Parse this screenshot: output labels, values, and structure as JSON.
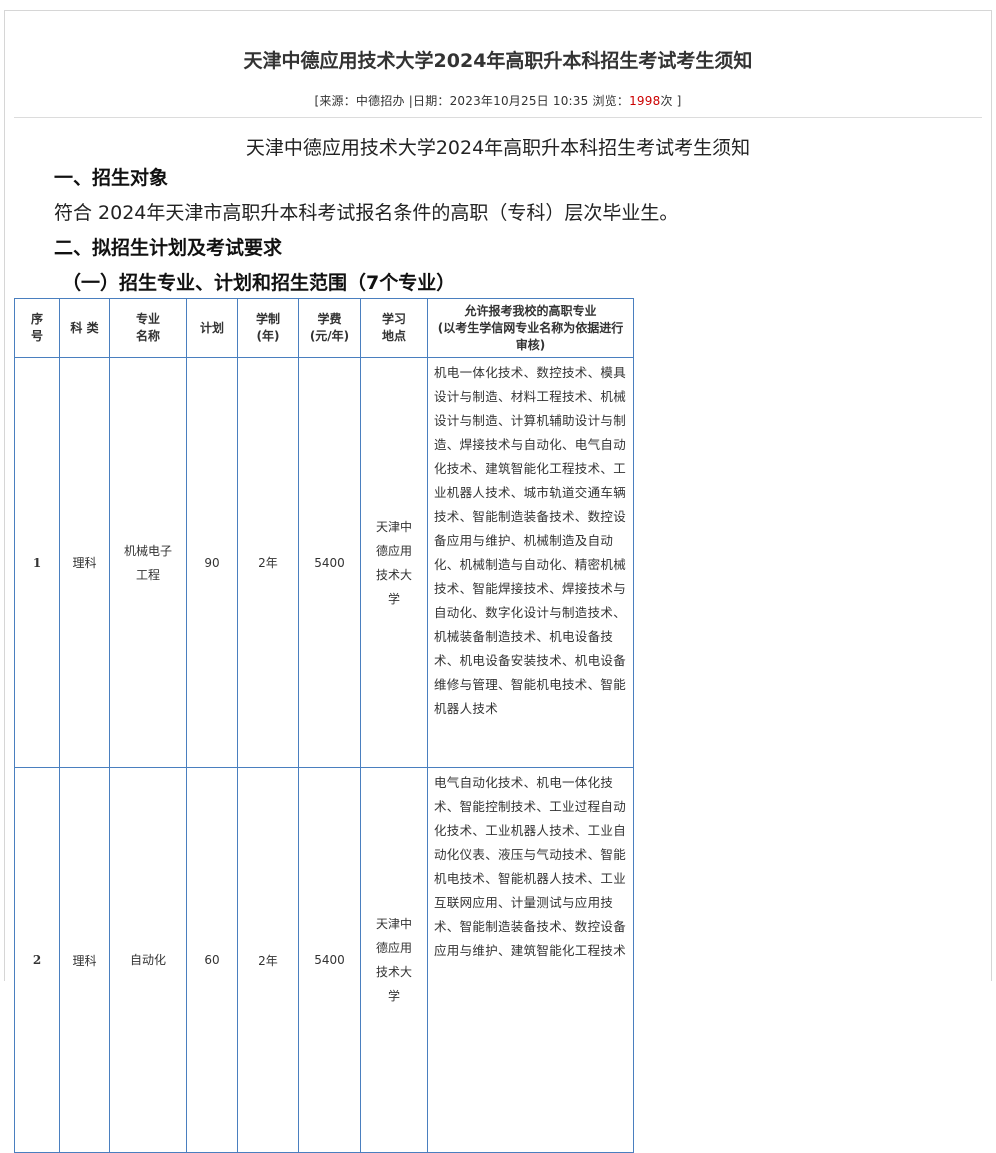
{
  "article": {
    "title": "天津中德应用技术大学2024年高职升本科招生考试考生须知",
    "meta_prefix": "[来源：中德招办 |日期：2023年10月25日 10:35  浏览：",
    "views": "1998",
    "meta_suffix": "次 ]",
    "subtitle": "天津中德应用技术大学2024年高职升本科招生考试考生须知",
    "section1_heading": "一、招生对象",
    "section1_text": "符合 2024年天津市高职升本科考试报名条件的高职（专科）层次毕业生。",
    "section2_heading": "二、拟招生计划及考试要求",
    "section2_sub": "（一）招生专业、计划和招生范围（7个专业）"
  },
  "table": {
    "headers": {
      "seq": "序号",
      "category": "科 类",
      "major": "专业名称",
      "plan": "计划",
      "years": "学制(年)",
      "fee": "学费(元/年)",
      "location": "学习地点",
      "allowed_title": "允许报考我校的高职专业",
      "allowed_note": "(以考生学信网专业名称为依据进行审核)"
    },
    "rows": [
      {
        "seq": "1",
        "category": "理科",
        "major": "机械电子工程",
        "plan": "90",
        "years": "2年",
        "fee": "5400",
        "location": "天津中德应用技术大学",
        "allowed": "机电一体化技术、数控技术、模具设计与制造、材料工程技术、机械设计与制造、计算机辅助设计与制造、焊接技术与自动化、电气自动化技术、建筑智能化工程技术、工业机器人技术、城市轨道交通车辆技术、智能制造装备技术、数控设备应用与维护、机械制造及自动化、机械制造与自动化、精密机械技术、智能焊接技术、焊接技术与自动化、数字化设计与制造技术、机械装备制造技术、机电设备技术、机电设备安装技术、机电设备维修与管理、智能机电技术、智能机器人技术"
      },
      {
        "seq": "2",
        "category": "理科",
        "major": "自动化",
        "plan": "60",
        "years": "2年",
        "fee": "5400",
        "location": "天津中德应用技术大学",
        "allowed": "电气自动化技术、机电一体化技术、智能控制技术、工业过程自动化技术、工业机器人技术、工业自动化仪表、液压与气动技术、智能机电技术、智能机器人技术、工业互联网应用、计量测试与应用技术、智能制造装备技术、数控设备应用与维护、建筑智能化工程技术"
      }
    ]
  }
}
